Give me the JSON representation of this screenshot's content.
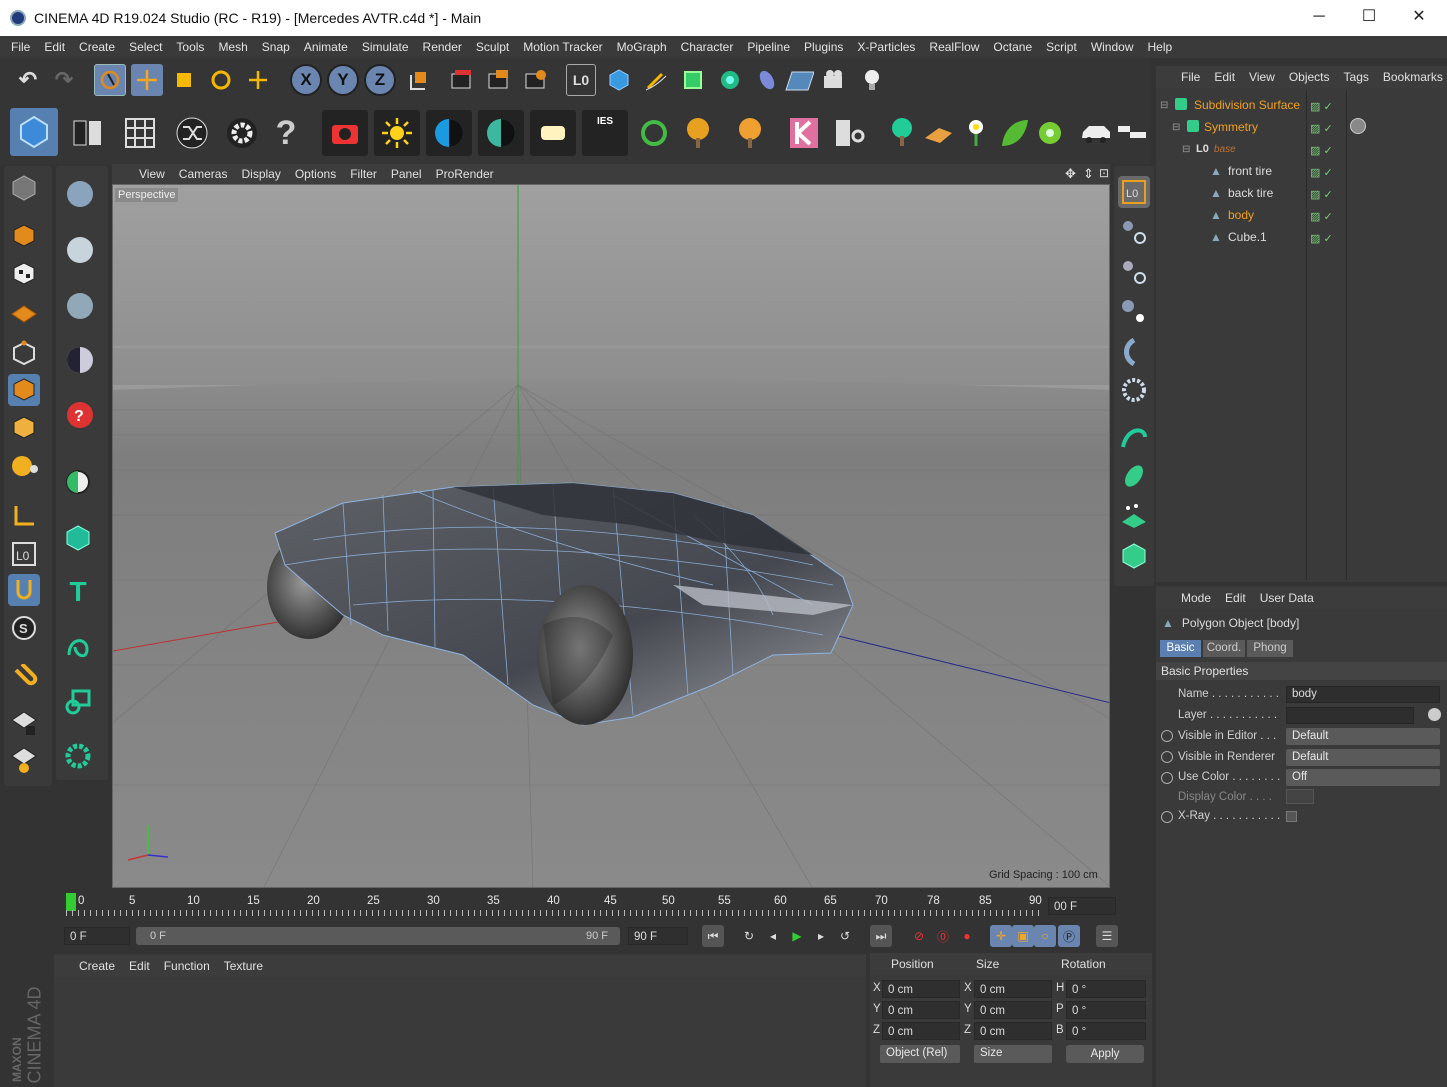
{
  "window": {
    "title": "CINEMA 4D R19.024 Studio (RC - R19) - [Mercedes AVTR.c4d *] - Main",
    "minimize": "─",
    "maximize": "☐",
    "close": "✕"
  },
  "menu": [
    "File",
    "Edit",
    "Create",
    "Select",
    "Tools",
    "Mesh",
    "Snap",
    "Animate",
    "Simulate",
    "Render",
    "Sculpt",
    "Motion Tracker",
    "MoGraph",
    "Character",
    "Pipeline",
    "Plugins",
    "X-Particles",
    "RealFlow",
    "Octane",
    "Script",
    "Window",
    "Help"
  ],
  "toolbar": {
    "axis_x": "X",
    "axis_y": "Y",
    "axis_z": "Z",
    "help": "?",
    "ies": "IES"
  },
  "viewport": {
    "menu": [
      "View",
      "Cameras",
      "Display",
      "Options",
      "Filter",
      "Panel",
      "ProRender"
    ],
    "label": "Perspective",
    "grid_spacing": "Grid Spacing : 100 cm"
  },
  "objects": {
    "menu": [
      "File",
      "Edit",
      "View",
      "Objects",
      "Tags",
      "Bookmarks"
    ],
    "items": [
      {
        "name": "Subdivision Surface",
        "color": "#f0a020"
      },
      {
        "name": "Symmetry",
        "color": "#f0a020"
      },
      {
        "name": "base",
        "color": "#c07030"
      },
      {
        "name": "front tire",
        "color": "#d8d8d8"
      },
      {
        "name": "back tire",
        "color": "#d8d8d8"
      },
      {
        "name": "body",
        "color": "#f0a020"
      },
      {
        "name": "Cube.1",
        "color": "#d8d8d8"
      }
    ]
  },
  "attributes": {
    "menu": [
      "Mode",
      "Edit",
      "User Data"
    ],
    "object_title": "Polygon Object [body]",
    "tabs": [
      "Basic",
      "Coord.",
      "Phong"
    ],
    "section": "Basic Properties",
    "name_label": "Name . . . . . . . . . . .",
    "name_value": "body",
    "layer_label": "Layer . . . . . . . . . . .",
    "vis_editor_label": "Visible in Editor . . .",
    "vis_editor_value": "Default",
    "vis_render_label": "Visible in Renderer",
    "vis_render_value": "Default",
    "use_color_label": "Use Color . . . . . . . .",
    "use_color_value": "Off",
    "display_color_label": "Display Color . . . .",
    "xray_label": "X-Ray . . . . . . . . . . ."
  },
  "timeline": {
    "ticks": [
      "0",
      "5",
      "10",
      "15",
      "20",
      "25",
      "30",
      "35",
      "40",
      "45",
      "50",
      "55",
      "60",
      "65",
      "70",
      "78",
      "85",
      "90"
    ],
    "current_frame": "00 F",
    "start": "0 F",
    "range_start": "0 F",
    "range_end": "90 F",
    "end": "90 F"
  },
  "material": {
    "menu": [
      "Create",
      "Edit",
      "Function",
      "Texture"
    ]
  },
  "coords": {
    "headers": [
      "Position",
      "Size",
      "Rotation"
    ],
    "rows": [
      {
        "a": "X",
        "pos": "0 cm",
        "b": "X",
        "size": "0 cm",
        "c": "H",
        "rot": "0 °"
      },
      {
        "a": "Y",
        "pos": "0 cm",
        "b": "Y",
        "size": "0 cm",
        "c": "P",
        "rot": "0 °"
      },
      {
        "a": "Z",
        "pos": "0 cm",
        "b": "Z",
        "size": "0 cm",
        "c": "B",
        "rot": "0 °"
      }
    ],
    "mode": "Object (Rel)",
    "size_mode": "Size",
    "apply": "Apply"
  },
  "branding": {
    "maxon": "MAXON",
    "product": "CINEMA 4D"
  }
}
